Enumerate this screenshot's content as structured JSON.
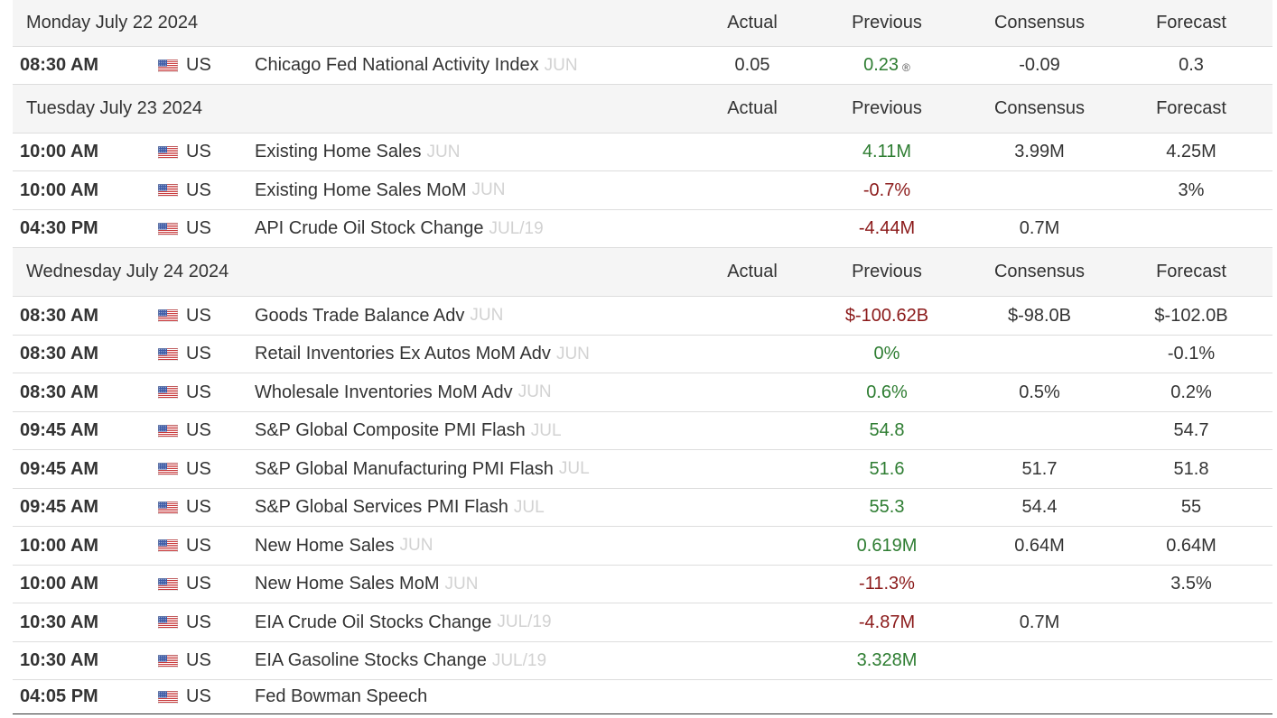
{
  "columns": {
    "actual": "Actual",
    "previous": "Previous",
    "consensus": "Consensus",
    "forecast": "Forecast"
  },
  "days": [
    {
      "date": "Monday July 22 2024",
      "events": [
        {
          "time": "08:30 AM",
          "country": "US",
          "event": "Chicago Fed National Activity Index",
          "ref": "JUN",
          "actual": "0.05",
          "previous": "0.23",
          "previous_dir": "pos",
          "revised": "®",
          "consensus": "-0.09",
          "forecast": "0.3"
        }
      ]
    },
    {
      "date": "Tuesday July 23 2024",
      "events": [
        {
          "time": "10:00 AM",
          "country": "US",
          "event": "Existing Home Sales",
          "ref": "JUN",
          "actual": "",
          "previous": "4.11M",
          "previous_dir": "pos",
          "consensus": "3.99M",
          "forecast": "4.25M"
        },
        {
          "time": "10:00 AM",
          "country": "US",
          "event": "Existing Home Sales MoM",
          "ref": "JUN",
          "actual": "",
          "previous": "-0.7%",
          "previous_dir": "neg",
          "consensus": "",
          "forecast": "3%"
        },
        {
          "time": "04:30 PM",
          "country": "US",
          "event": "API Crude Oil Stock Change",
          "ref": "JUL/19",
          "actual": "",
          "previous": "-4.44M",
          "previous_dir": "neg",
          "consensus": "0.7M",
          "forecast": ""
        }
      ]
    },
    {
      "date": "Wednesday July 24 2024",
      "events": [
        {
          "time": "08:30 AM",
          "country": "US",
          "event": "Goods Trade Balance Adv",
          "ref": "JUN",
          "actual": "",
          "previous": "$-100.62B",
          "previous_dir": "neg",
          "consensus": "$-98.0B",
          "forecast": "$-102.0B"
        },
        {
          "time": "08:30 AM",
          "country": "US",
          "event": "Retail Inventories Ex Autos MoM Adv",
          "ref": "JUN",
          "actual": "",
          "previous": "0%",
          "previous_dir": "pos",
          "consensus": "",
          "forecast": "-0.1%"
        },
        {
          "time": "08:30 AM",
          "country": "US",
          "event": "Wholesale Inventories MoM Adv",
          "ref": "JUN",
          "actual": "",
          "previous": "0.6%",
          "previous_dir": "pos",
          "consensus": "0.5%",
          "forecast": "0.2%"
        },
        {
          "time": "09:45 AM",
          "country": "US",
          "event": "S&P Global Composite PMI Flash",
          "ref": "JUL",
          "actual": "",
          "previous": "54.8",
          "previous_dir": "pos",
          "consensus": "",
          "forecast": "54.7"
        },
        {
          "time": "09:45 AM",
          "country": "US",
          "event": "S&P Global Manufacturing PMI Flash",
          "ref": "JUL",
          "actual": "",
          "previous": "51.6",
          "previous_dir": "pos",
          "consensus": "51.7",
          "forecast": "51.8"
        },
        {
          "time": "09:45 AM",
          "country": "US",
          "event": "S&P Global Services PMI Flash",
          "ref": "JUL",
          "actual": "",
          "previous": "55.3",
          "previous_dir": "pos",
          "consensus": "54.4",
          "forecast": "55"
        },
        {
          "time": "10:00 AM",
          "country": "US",
          "event": "New Home Sales",
          "ref": "JUN",
          "actual": "",
          "previous": "0.619M",
          "previous_dir": "pos",
          "consensus": "0.64M",
          "forecast": "0.64M"
        },
        {
          "time": "10:00 AM",
          "country": "US",
          "event": "New Home Sales MoM",
          "ref": "JUN",
          "actual": "",
          "previous": "-11.3%",
          "previous_dir": "neg",
          "consensus": "",
          "forecast": "3.5%"
        },
        {
          "time": "10:30 AM",
          "country": "US",
          "event": "EIA Crude Oil Stocks Change",
          "ref": "JUL/19",
          "actual": "",
          "previous": "-4.87M",
          "previous_dir": "neg",
          "consensus": "0.7M",
          "forecast": ""
        },
        {
          "time": "10:30 AM",
          "country": "US",
          "event": "EIA Gasoline Stocks Change",
          "ref": "JUL/19",
          "actual": "",
          "previous": "3.328M",
          "previous_dir": "pos",
          "consensus": "",
          "forecast": ""
        },
        {
          "time": "04:05 PM",
          "country": "US",
          "event": "Fed Bowman Speech",
          "ref": "",
          "actual": "",
          "previous": "",
          "previous_dir": "",
          "consensus": "",
          "forecast": ""
        }
      ]
    }
  ],
  "colors": {
    "positive": "#2e7d32",
    "negative": "#8b1a1a",
    "reference_period": "#d2d2d2",
    "header_bg": "#f5f5f5"
  },
  "icons": {
    "flag": "us-flag-icon",
    "revised": "revised-icon"
  }
}
